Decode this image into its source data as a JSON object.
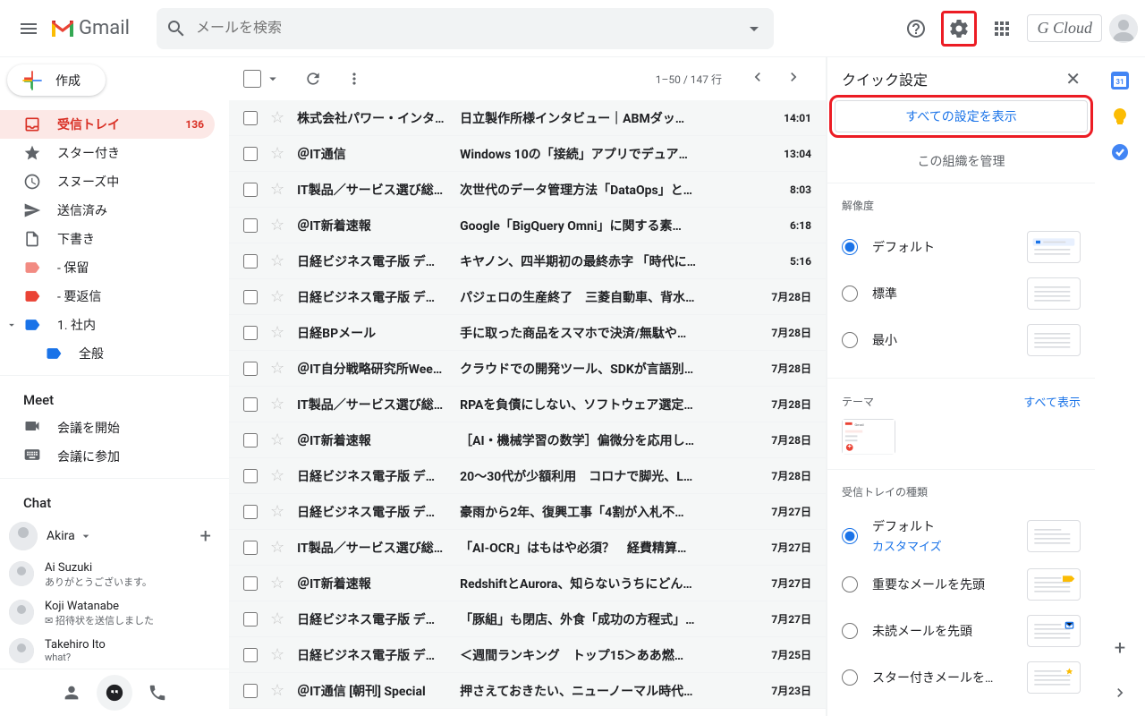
{
  "header": {
    "logo_text": "Gmail",
    "search_placeholder": "メールを検索",
    "brand": "G Cloud"
  },
  "sidebar": {
    "compose": "作成",
    "items": [
      {
        "label": "受信トレイ",
        "count": "136",
        "icon": "inbox",
        "active": true
      },
      {
        "label": "スター付き",
        "icon": "star"
      },
      {
        "label": "スヌーズ中",
        "icon": "clock"
      },
      {
        "label": "送信済み",
        "icon": "send"
      },
      {
        "label": "下書き",
        "icon": "file"
      },
      {
        "label": "- 保留",
        "icon": "label-pink"
      },
      {
        "label": "- 要返信",
        "icon": "label-red"
      },
      {
        "label": "1. 社内",
        "icon": "label-blue",
        "expand": true
      },
      {
        "label": "全般",
        "icon": "label-blue",
        "sub": true
      }
    ],
    "meet_title": "Meet",
    "meet_items": [
      {
        "label": "会議を開始",
        "icon": "video"
      },
      {
        "label": "会議に参加",
        "icon": "keyboard"
      }
    ],
    "chat_title": "Chat",
    "chat_user": "Akira",
    "contacts": [
      {
        "name": "Ai Suzuki",
        "sub": "ありがとうございます。"
      },
      {
        "name": "Koji Watanabe",
        "sub": "✉ 招待状を送信しました"
      },
      {
        "name": "Takehiro Ito",
        "sub": "what?"
      }
    ]
  },
  "toolbar": {
    "pagination": "1–50 / 147 行"
  },
  "emails": [
    {
      "sender": "株式会社パワー・インタ…",
      "subject": "日立製作所様インタビュー｜ABMダッ…",
      "time": "14:01"
    },
    {
      "sender": "＠IT通信",
      "subject": "Windows 10の「接続」アプリでデュア…",
      "time": "13:04"
    },
    {
      "sender": "IT製品／サービス選び総…",
      "subject": "次世代のデータ管理方法「DataOps」と…",
      "time": "8:03"
    },
    {
      "sender": "＠IT新着速報",
      "subject": "Google「BigQuery Omni」に関する素…",
      "time": "6:18"
    },
    {
      "sender": "日経ビジネス電子版 デ…",
      "subject": "キヤノン、四半期初の最終赤字 「時代に…",
      "time": "5:16"
    },
    {
      "sender": "日経ビジネス電子版 デ…",
      "subject": "パジェロの生産終了　三菱自動車、背水…",
      "time": "7月28日"
    },
    {
      "sender": "日経BPメール",
      "subject": "手に取った商品をスマホで決済/無駄や…",
      "time": "7月28日"
    },
    {
      "sender": "＠IT自分戦略研究所Wee…",
      "subject": "クラウドでの開発ツール、SDKが言語別…",
      "time": "7月28日"
    },
    {
      "sender": "IT製品／サービス選び総…",
      "subject": "RPAを負債にしない、ソフトウェア選定…",
      "time": "7月28日"
    },
    {
      "sender": "＠IT新着速報",
      "subject": "［AI・機械学習の数学］偏微分を応用し…",
      "time": "7月28日"
    },
    {
      "sender": "日経ビジネス電子版 デ…",
      "subject": "20～30代が少額利用　コロナで脚光、L…",
      "time": "7月28日"
    },
    {
      "sender": "日経ビジネス電子版 デ…",
      "subject": "豪雨から2年、復興工事「4割が入札不…",
      "time": "7月27日"
    },
    {
      "sender": "IT製品／サービス選び総…",
      "subject": "「AI-OCR」はもはや必須？　経費精算…",
      "time": "7月27日"
    },
    {
      "sender": "＠IT新着速報",
      "subject": "RedshiftとAurora、知らないうちにどん…",
      "time": "7月27日"
    },
    {
      "sender": "日経ビジネス電子版 デ…",
      "subject": "「豚組」も閉店、外食「成功の方程式」…",
      "time": "7月27日"
    },
    {
      "sender": "日経ビジネス電子版 デ…",
      "subject": "＜週間ランキング　トップ15＞ああ燃…",
      "time": "7月25日"
    },
    {
      "sender": "＠IT通信 [朝刊] Special",
      "subject": "押さえておきたい、ニューノーマル時代…",
      "time": "7月23日"
    }
  ],
  "panel": {
    "title": "クイック設定",
    "all_settings": "すべての設定を表示",
    "org_manage": "この組織を管理",
    "density_title": "解像度",
    "density_opts": [
      "デフォルト",
      "標準",
      "最小"
    ],
    "theme_title": "テーマ",
    "show_all": "すべて表示",
    "inbox_type_title": "受信トレイの種類",
    "inbox_opts": [
      {
        "label": "デフォルト",
        "sub": "カスタマイズ"
      },
      {
        "label": "重要なメールを先頭"
      },
      {
        "label": "未読メールを先頭"
      },
      {
        "label": "スター付きメールを…"
      }
    ]
  }
}
